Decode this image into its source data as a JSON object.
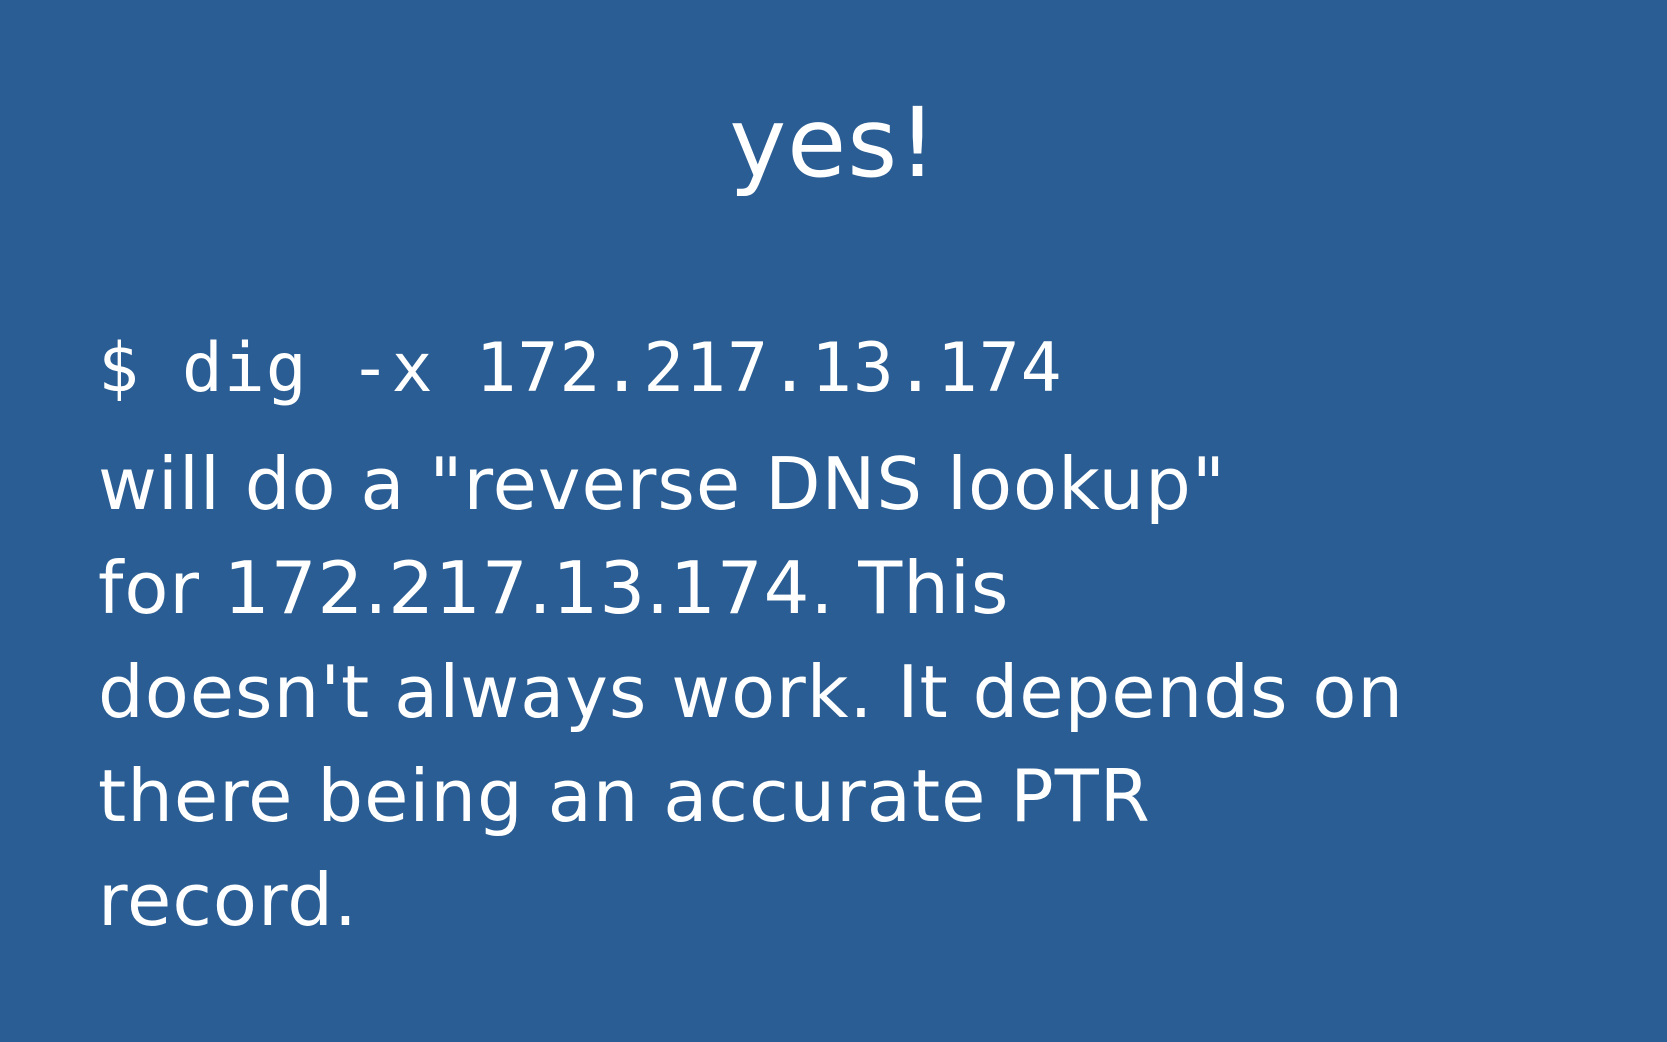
{
  "slide": {
    "background": "#2a5d93",
    "text_color": "#ffffff",
    "title": "yes!",
    "command": "$ dig -x 172.217.13.174",
    "body_lines": [
      "will do a \"reverse DNS lookup\"",
      "for 172.217.13.174. This",
      "doesn't always work. It depends on",
      "there being an accurate PTR",
      "record."
    ]
  }
}
